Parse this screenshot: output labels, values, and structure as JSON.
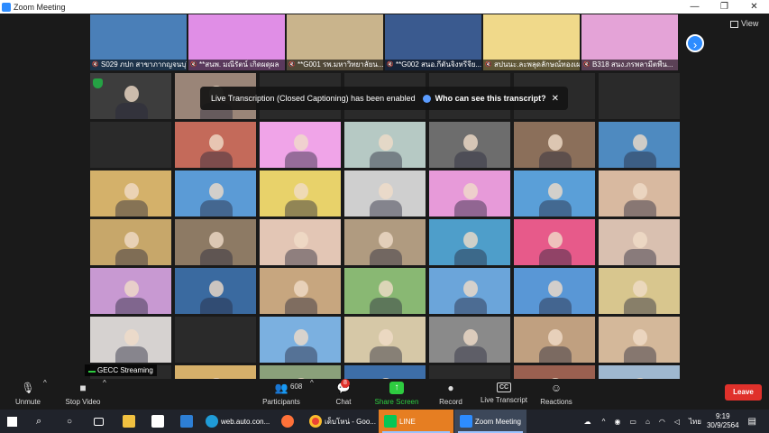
{
  "window": {
    "title": "Zoom Meeting",
    "controls": [
      "—",
      "❐",
      "✕"
    ]
  },
  "top_strip": [
    {
      "name": "S029 ภปก สาขาภากญจนบุรี",
      "bg": "#4a7fb8"
    },
    {
      "name": "**สนพ. มณีรัตน์ เกิดผดุผล",
      "bg": "#e08ee6"
    },
    {
      "name": "**G001 รพ.มหาวิทยาลัยน...",
      "bg": "#c9b48c"
    },
    {
      "name": "**G002 สนอ.กีตันจิงหรีจีย...",
      "bg": "#3a5a8f"
    },
    {
      "name": "สปนนะ.ละพลุดลักษณ์ทองเผย",
      "bg": "#f0d98a"
    },
    {
      "name": "B318 สนง.ภรพลามีตพืน...",
      "bg": "#e4a3d7"
    }
  ],
  "view_label": "View",
  "banner": {
    "text": "Live Transcription (Closed Captioning) has been enabled",
    "who": "Who can see this transcript?",
    "close": "✕"
  },
  "streaming_label": "GECC Streaming",
  "grid_colors": [
    [
      "#3d3d3d",
      "#9a8578",
      "#2a2a2a",
      "#2a2a2a",
      "#2a2a2a",
      "#2a2a2a",
      "#2a2a2a"
    ],
    [
      "#2a2a2a",
      "#c46a5a",
      "#f0a4e8",
      "#b6c9c4",
      "#6d6d6d",
      "#8b6f5a",
      "#4e8ac0"
    ],
    [
      "#d4b16a",
      "#5b9bd6",
      "#e8d26a",
      "#cfcfcf",
      "#e79ad9",
      "#5a9fd8",
      "#d8b9a0"
    ],
    [
      "#c7a76a",
      "#8d7a64",
      "#e3c6b5",
      "#b09b80",
      "#4e9eca",
      "#e75a8a",
      "#d9c0b0"
    ],
    [
      "#c899d2",
      "#3a6aa0",
      "#c7a67f",
      "#89b873",
      "#6ba5da",
      "#5997d6",
      "#d8c68e"
    ],
    [
      "#d6d2d0",
      "#2a2a2a",
      "#7bb0e0",
      "#d6c8a7",
      "#8a8a8a",
      "#c0a080",
      "#d4b89a"
    ],
    [
      "#2a2a2a",
      "#d6b06a",
      "#8aa07a",
      "#3d6ea8",
      "#2a2a2a",
      "#9a6050",
      "#9fb8d0"
    ]
  ],
  "toolbar": {
    "unmute": "Unmute",
    "stop_video": "Stop Video",
    "participants": "Participants",
    "participant_count": "608",
    "chat": "Chat",
    "chat_badge": "8",
    "share": "Share Screen",
    "record": "Record",
    "live_transcript": "Live Transcript",
    "cc_icon_text": "CC",
    "reactions": "Reactions",
    "leave": "Leave"
  },
  "taskbar": {
    "edge_label": "web.auto.con...",
    "chrome_label": "เด็บโหน่ - Goo...",
    "line_label": "LINE",
    "zoom_label": "Zoom Meeting",
    "lang": "ไทย",
    "time": "9:19",
    "date": "30/9/2564"
  }
}
